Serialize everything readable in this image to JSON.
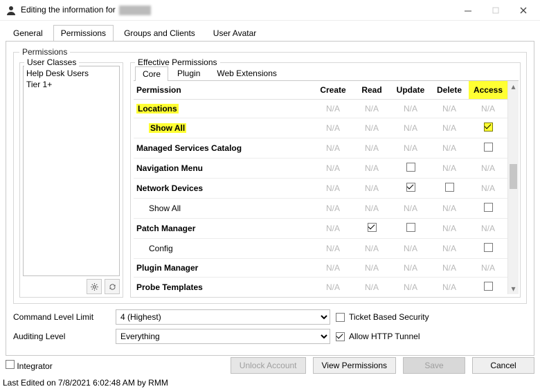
{
  "window": {
    "title_prefix": "Editing the information for ",
    "minimize_tip": "Minimize",
    "maximize_tip": "Maximize",
    "close_tip": "Close"
  },
  "tabs": {
    "general": "General",
    "permissions": "Permissions",
    "groups": "Groups and Clients",
    "avatar": "User Avatar"
  },
  "permissions_group_label": "Permissions",
  "user_classes": {
    "legend": "User Classes",
    "items": [
      "Help Desk Users",
      "Tier 1+"
    ]
  },
  "effective": {
    "legend": "Effective Permissions",
    "subtabs": {
      "core": "Core",
      "plugin": "Plugin",
      "webext": "Web Extensions"
    },
    "columns": {
      "permission": "Permission",
      "create": "Create",
      "read": "Read",
      "update": "Update",
      "delete": "Delete",
      "access": "Access"
    },
    "na": "N/A",
    "rows": [
      {
        "name": "Locations",
        "highlight": true,
        "child": false,
        "cells": {
          "create": "na",
          "read": "na",
          "update": "na",
          "delete": "na",
          "access": "na"
        }
      },
      {
        "name": "Show All",
        "highlight": true,
        "child": true,
        "cells": {
          "create": "na",
          "read": "na",
          "update": "na",
          "delete": "na",
          "access": "chk_checked_hl"
        }
      },
      {
        "name": "Managed Services Catalog",
        "highlight": false,
        "child": false,
        "cells": {
          "create": "na",
          "read": "na",
          "update": "na",
          "delete": "na",
          "access": "chk"
        }
      },
      {
        "name": "Navigation Menu",
        "highlight": false,
        "child": false,
        "cells": {
          "create": "na",
          "read": "na",
          "update": "chk",
          "delete": "na",
          "access": "na"
        }
      },
      {
        "name": "Network Devices",
        "highlight": false,
        "child": false,
        "cells": {
          "create": "na",
          "read": "na",
          "update": "chk_checked",
          "delete": "chk",
          "access": "na"
        }
      },
      {
        "name": "Show All",
        "highlight": false,
        "child": true,
        "cells": {
          "create": "na",
          "read": "na",
          "update": "na",
          "delete": "na",
          "access": "chk"
        }
      },
      {
        "name": "Patch Manager",
        "highlight": false,
        "child": false,
        "cells": {
          "create": "na",
          "read": "chk_checked",
          "update": "chk",
          "delete": "na",
          "access": "na"
        }
      },
      {
        "name": "Config",
        "highlight": false,
        "child": true,
        "cells": {
          "create": "na",
          "read": "na",
          "update": "na",
          "delete": "na",
          "access": "chk"
        }
      },
      {
        "name": "Plugin Manager",
        "highlight": false,
        "child": false,
        "cells": {
          "create": "na",
          "read": "na",
          "update": "na",
          "delete": "na",
          "access": "na"
        }
      },
      {
        "name": "Probe Templates",
        "highlight": false,
        "child": false,
        "cells": {
          "create": "na",
          "read": "na",
          "update": "na",
          "delete": "na",
          "access": "chk"
        }
      }
    ]
  },
  "settings": {
    "command_level_label": "Command Level Limit",
    "command_level_value": "4 (Highest)",
    "auditing_level_label": "Auditing Level",
    "auditing_level_value": "Everything",
    "ticket_based_security": {
      "label": "Ticket Based Security",
      "checked": false
    },
    "allow_http_tunnel": {
      "label": "Allow HTTP Tunnel",
      "checked": true
    }
  },
  "buttons": {
    "integrator": "Integrator",
    "unlock_account": "Unlock Account",
    "view_permissions": "View Permissions",
    "save": "Save",
    "cancel": "Cancel"
  },
  "status": "Last Edited on 7/8/2021 6:02:48 AM by RMM"
}
